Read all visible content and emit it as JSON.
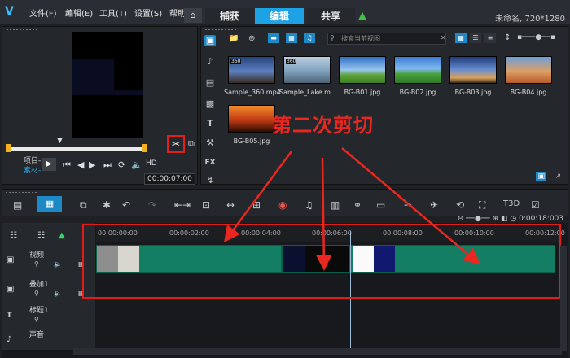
{
  "menu": {
    "items": [
      "文件(F)",
      "编辑(E)",
      "工具(T)",
      "设置(S)",
      "帮助"
    ]
  },
  "tabs": [
    "捕获",
    "编辑",
    "共享"
  ],
  "project_title": "未命名, 720*1280",
  "preview": {
    "project_label": "项目-",
    "clip_label": "素材-",
    "timecode": "00:00:07:00"
  },
  "library": {
    "search_placeholder": "搜索当前视图",
    "items": [
      {
        "label": "Sample_360.mp4",
        "badge": "360"
      },
      {
        "label": "Sample_Lake.m...",
        "badge": "360"
      },
      {
        "label": "BG-B01.jpg"
      },
      {
        "label": "BG-B02.jpg"
      },
      {
        "label": "BG-B03.jpg"
      },
      {
        "label": "BG-B04.jpg"
      },
      {
        "label": "BG-B05.jpg"
      }
    ]
  },
  "annotation": "第二次剪切",
  "timeline": {
    "zoom_readout": "0:00:18:003",
    "ruler": [
      "00:00:00:00",
      "00:00:02:00",
      "00:00:04:00",
      "00:00:06:00",
      "00:00:08:00",
      "00:00:10:00",
      "00:00:12:00"
    ],
    "tracks": [
      "视频",
      "叠加1",
      "标题1",
      "声音"
    ]
  },
  "colors": {
    "accent": "#1ea2e6",
    "annotation_red": "#e9261f",
    "clip_green": "#137e64"
  }
}
